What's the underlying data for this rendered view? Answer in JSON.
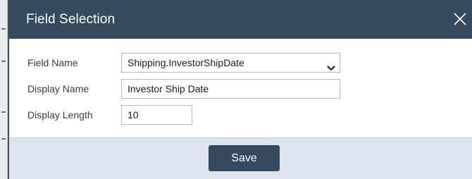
{
  "dialog": {
    "title": "Field Selection",
    "close_icon": "close-icon"
  },
  "form": {
    "field_name": {
      "label": "Field Name",
      "value": "Shipping.InvestorShipDate",
      "icon": "chevron-down-icon"
    },
    "display_name": {
      "label": "Display Name",
      "value": "Investor Ship Date"
    },
    "display_length": {
      "label": "Display Length",
      "value": "10"
    }
  },
  "footer": {
    "save_label": "Save"
  },
  "colors": {
    "header_bg": "#35495f",
    "footer_bg": "#dde4ec",
    "button_bg": "#35495f"
  }
}
